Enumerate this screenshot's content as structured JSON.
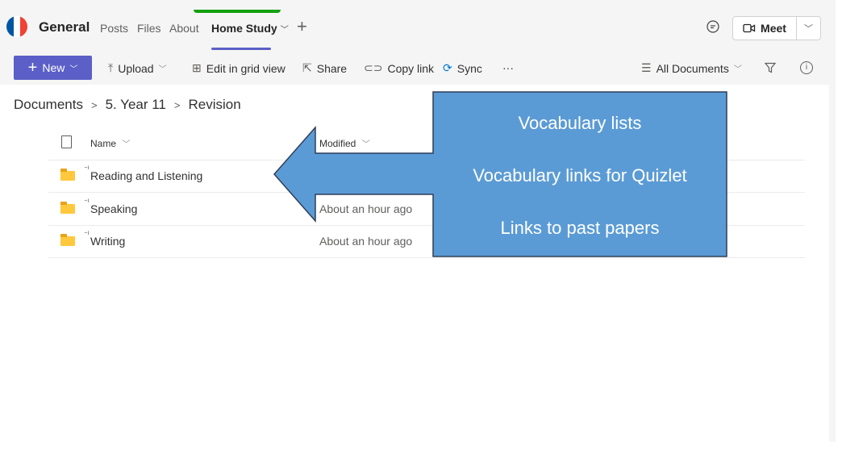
{
  "header": {
    "title": "General",
    "tabs": [
      {
        "label": "Posts"
      },
      {
        "label": "Files"
      },
      {
        "label": "About"
      },
      {
        "label": "Home Study"
      }
    ],
    "add_tab": "+",
    "meet_label": "Meet",
    "meet_dropdown": "⌄"
  },
  "toolbar": {
    "new_label": "New",
    "upload_label": "Upload",
    "grid_label": "Edit in grid view",
    "share_label": "Share",
    "copy_link_label": "Copy link",
    "sync_label": "Sync",
    "more_label": "···",
    "view_label": "All Documents",
    "info": "i"
  },
  "breadcrumb": [
    "Documents",
    "5. Year 11",
    "Revision"
  ],
  "list": {
    "columns": {
      "name": "Name",
      "modified": "Modified"
    },
    "rows": [
      {
        "name": "Reading and Listening",
        "modified": ""
      },
      {
        "name": "Speaking",
        "modified": "About an hour ago"
      },
      {
        "name": "Writing",
        "modified": "About an hour ago"
      }
    ]
  },
  "callout": {
    "lines": [
      "Vocabulary lists",
      "Vocabulary links for Quizlet",
      "Links to past papers"
    ],
    "fill": "#5b9bd5",
    "stroke": "#2f3e58"
  },
  "colors": {
    "accent": "#5b5fc7",
    "flag_blue": "#0055a4",
    "flag_red": "#ef4135"
  }
}
